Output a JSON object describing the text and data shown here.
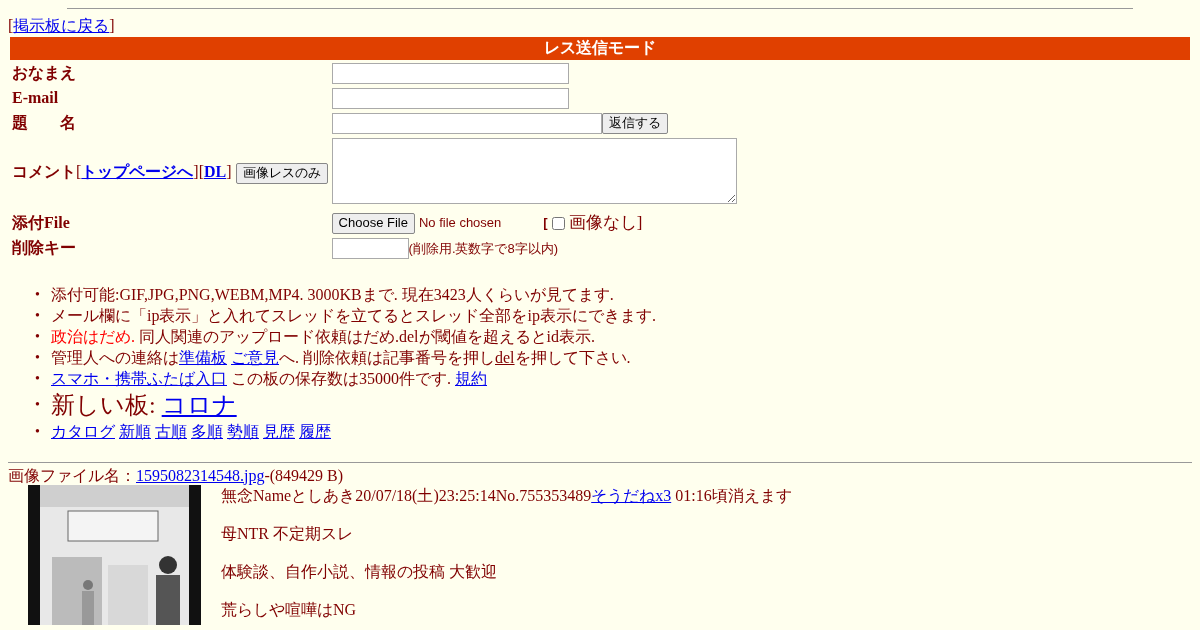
{
  "back_nav": [
    {
      "kind": "text",
      "text": "["
    },
    {
      "kind": "link",
      "text": "掲示板に戻る"
    },
    {
      "kind": "text",
      "text": "]"
    }
  ],
  "form": {
    "title": "レス送信モード",
    "rows": [
      {
        "kind": "input",
        "label": [
          {
            "kind": "text",
            "text": "おなまえ"
          }
        ]
      },
      {
        "kind": "input",
        "label": [
          {
            "kind": "text",
            "text": "E-mail"
          }
        ]
      },
      {
        "kind": "input_button",
        "label": [
          {
            "kind": "text",
            "text": "題　　名"
          }
        ],
        "button": "返信する"
      },
      {
        "kind": "textarea",
        "label": [
          {
            "kind": "text",
            "text": "コメント"
          },
          {
            "kind": "plain",
            "text": "["
          },
          {
            "kind": "link",
            "text": "トップページへ"
          },
          {
            "kind": "plain",
            "text": "]["
          },
          {
            "kind": "link",
            "text": "DL"
          },
          {
            "kind": "plain",
            "text": "]"
          },
          {
            "kind": "button",
            "text": "画像レスのみ"
          }
        ]
      },
      {
        "kind": "file",
        "label": [
          {
            "kind": "text",
            "text": "添付File"
          }
        ],
        "button": "Choose File",
        "status": "No file chosen",
        "open": "[",
        "checkbox_label": "画像なし",
        "checked": false,
        "close": "]"
      },
      {
        "kind": "key",
        "label": [
          {
            "kind": "text",
            "text": "削除キー"
          }
        ],
        "note": "(削除用.英数字で8字以内)"
      }
    ]
  },
  "notes": [
    {
      "marker": "•",
      "segments": [
        {
          "kind": "text",
          "text": "添付可能:GIF,JPG,PNG,WEBM,MP4. 3000KBまで. 現在3423人くらいが見てます."
        }
      ]
    },
    {
      "marker": "•",
      "segments": [
        {
          "kind": "text",
          "text": "メール欄に「ip表示」と入れてスレッドを立てるとスレッド全部をip表示にできます."
        }
      ]
    },
    {
      "marker": "•",
      "segments": [
        {
          "kind": "red",
          "text": "政治はだめ."
        },
        {
          "kind": "text",
          "text": " 同人関連のアップロード依頼はだめ.delが閾値を超えるとid表示."
        }
      ]
    },
    {
      "marker": "•",
      "segments": [
        {
          "kind": "text",
          "text": "管理人への連絡は"
        },
        {
          "kind": "link",
          "text": "準備板"
        },
        {
          "kind": "link",
          "text": "ご意見"
        },
        {
          "kind": "text",
          "text": "へ. 削除依頼は記事番号を押し"
        },
        {
          "kind": "underline",
          "text": "del"
        },
        {
          "kind": "text",
          "text": "を押して下さい."
        }
      ]
    },
    {
      "marker": "•",
      "segments": [
        {
          "kind": "link",
          "text": "スマホ・携帯ふたば入口"
        },
        {
          "kind": "text",
          "text": " この板の保存数は35000件です. "
        },
        {
          "kind": "link",
          "text": "規約"
        }
      ]
    },
    {
      "marker": "•",
      "segments": [
        {
          "kind": "big",
          "text": "新しい板: "
        },
        {
          "kind": "biglink",
          "text": "コロナ"
        }
      ]
    },
    {
      "marker": "•",
      "segments": [
        {
          "kind": "link",
          "text": "カタログ"
        },
        {
          "kind": "link",
          "text": "新順"
        },
        {
          "kind": "link",
          "text": "古順"
        },
        {
          "kind": "link",
          "text": "多順"
        },
        {
          "kind": "link",
          "text": "勢順"
        },
        {
          "kind": "link",
          "text": "見歴"
        },
        {
          "kind": "link",
          "text": "履歴"
        }
      ]
    }
  ],
  "post": {
    "file_line": [
      {
        "kind": "text",
        "text": "画像ファイル名："
      },
      {
        "kind": "link",
        "text": "1595082314548.jpg"
      },
      {
        "kind": "text",
        "text": "-(849429 B)"
      }
    ],
    "header": [
      {
        "kind": "text",
        "text": "無念Nameとしあき20/07/18(土)23:25:14No.755353489"
      },
      {
        "kind": "link",
        "text": "そうだねx3"
      },
      {
        "kind": "text",
        "text": " 01:16頃消えます"
      }
    ],
    "body": [
      "母NTR 不定期スレ",
      "体験談、自作小説、情報の投稿 大歓迎",
      "荒らしや喧嘩はNG"
    ]
  }
}
